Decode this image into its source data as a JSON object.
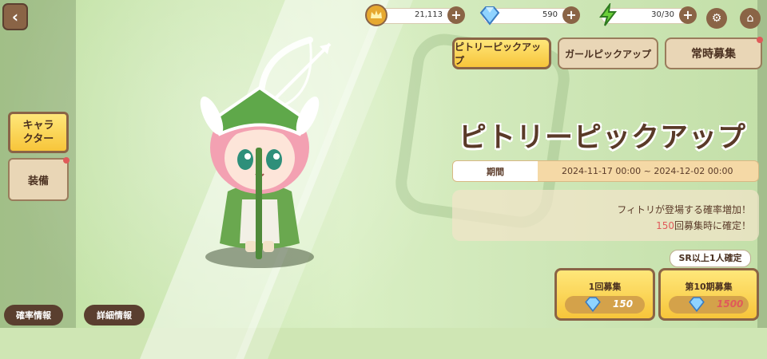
{
  "header": {
    "back_icon": "chevron-left-icon",
    "gold": "21,113",
    "gems": "590",
    "stamina": "30/30",
    "settings_icon": "gear-icon",
    "home_icon": "home-icon"
  },
  "tabs": [
    {
      "label": "ピトリーピックアップ",
      "active": true
    },
    {
      "label": "ガールピックアップ",
      "active": false
    },
    {
      "label": "常時募集",
      "active": false
    }
  ],
  "sidebar": [
    {
      "label": "キャラクター",
      "active": true
    },
    {
      "label": "装備",
      "active": false
    }
  ],
  "banner": {
    "title": "ピトリーピックアップ",
    "period_label": "期間",
    "period_value": "2024-11-17 00:00 ~ 2024-12-02 00:00",
    "desc_line1": "フィトリが登場する確率増加！",
    "desc_line2_num": "150",
    "desc_line2_text": "回募集時に確定！"
  },
  "pulls": {
    "bubble": "SR以上1人確定",
    "single_label": "1回募集",
    "single_cost": "150",
    "multi_label": "第10期募集",
    "multi_cost": "1500"
  },
  "footer": {
    "rates_label": "確率情報",
    "details_label": "詳細情報"
  },
  "colors": {
    "brown": "#8a6446",
    "gold": "#f7c53a",
    "red": "#e05a5a"
  }
}
